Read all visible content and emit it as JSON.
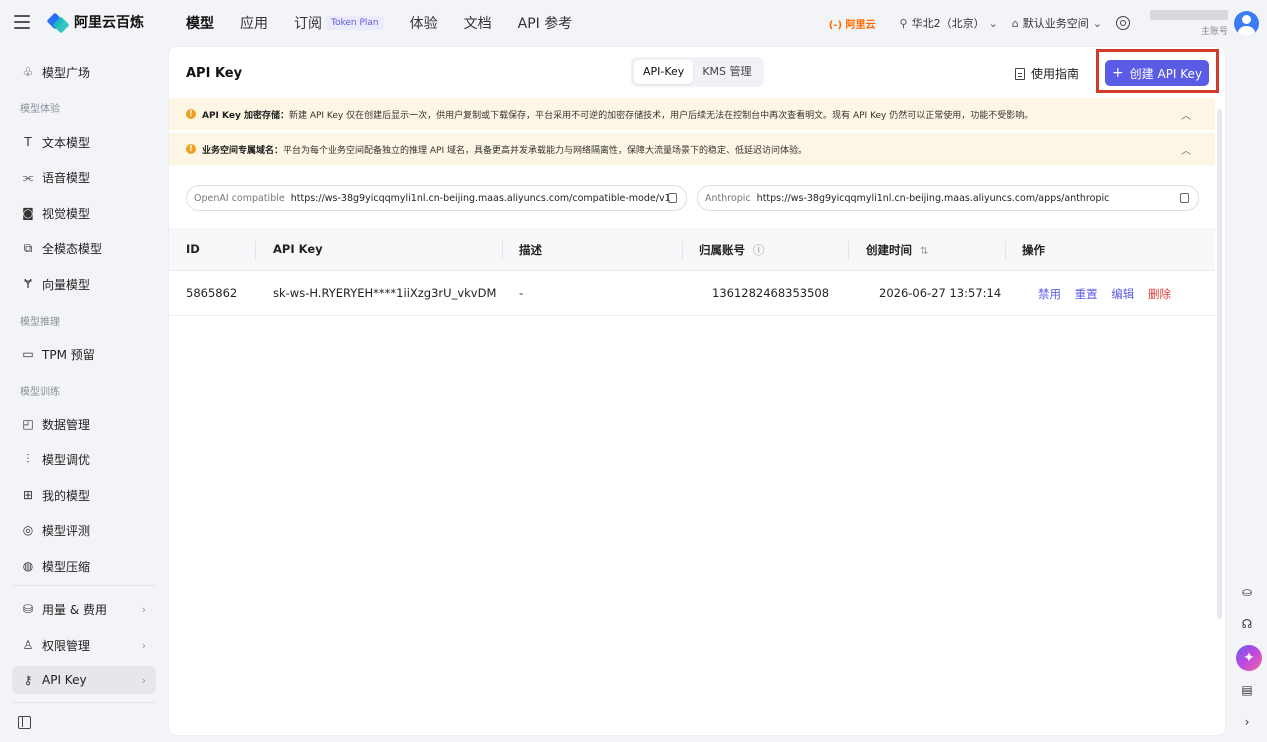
{
  "topbar": {
    "brand": "阿里云百炼",
    "nav": [
      {
        "label": "模型",
        "active": true
      },
      {
        "label": "应用",
        "active": false
      },
      {
        "label": "订阅",
        "badge": "Token Plan",
        "active": false
      },
      {
        "label": "体验",
        "active": false
      },
      {
        "label": "文档",
        "active": false
      },
      {
        "label": "API 参考",
        "active": false
      }
    ],
    "aliyun_logo": "(-) 阿里云",
    "region": "华北2（北京）",
    "workspace": "默认业务空间",
    "account_sub": "主账号"
  },
  "sidebar": {
    "items": {
      "model_square": "模型广场",
      "group_experience": "模型体验",
      "text_model": "文本模型",
      "voice_model": "语音模型",
      "vision_model": "视觉模型",
      "omni_model": "全模态模型",
      "vector_model": "向量模型",
      "group_inference": "模型推理",
      "tpm": "TPM 预留",
      "group_training": "模型训练",
      "data_mgmt": "数据管理",
      "finetune": "模型调优",
      "my_models": "我的模型",
      "evaluation": "模型评测",
      "compression": "模型压缩",
      "usage_cost": "用量 & 费用",
      "permissions": "权限管理",
      "api_key": "API Key"
    }
  },
  "main": {
    "title": "API Key",
    "tabs": [
      "API-Key",
      "KMS 管理"
    ],
    "active_tab": "API-Key",
    "guide_label": "使用指南",
    "create_label": "创建 API Key",
    "notices": [
      {
        "bold": "API Key 加密存储：",
        "text": "新建 API Key 仅在创建后显示一次，供用户复制或下载保存，平台采用不可逆的加密存储技术，用户后续无法在控制台中再次查看明文。现有 API Key 仍然可以正常使用，功能不受影响。"
      },
      {
        "bold": "业务空间专属域名：",
        "text": "平台为每个业务空间配备独立的推理 API 域名，具备更高并发承载能力与网络隔离性，保障大流量场景下的稳定、低延迟访问体验。"
      }
    ],
    "endpoints": [
      {
        "label": "OpenAI compatible",
        "url": "https://ws-38g9yicqqmyli1nl.cn-beijing.maas.aliyuncs.com/compatible-mode/v1"
      },
      {
        "label": "Anthropic",
        "url": "https://ws-38g9yicqqmyli1nl.cn-beijing.maas.aliyuncs.com/apps/anthropic"
      }
    ],
    "table": {
      "headers": [
        "ID",
        "API Key",
        "描述",
        "归属账号",
        "创建时间",
        "操作"
      ],
      "rows": [
        {
          "id": "5865862",
          "key": "sk-ws-H.RYERYEH****1iiXzg3rU_vkvDM",
          "desc": "-",
          "account": "1361282468353508",
          "created": "2026-06-27 13:57:14",
          "actions": [
            "禁用",
            "重置",
            "编辑",
            "删除"
          ]
        }
      ]
    }
  },
  "colors": {
    "accent": "#5b5ce6",
    "danger": "#e03a3a",
    "highlight_box": "#d03a2b",
    "notice_bg": "#fdf6e4"
  }
}
